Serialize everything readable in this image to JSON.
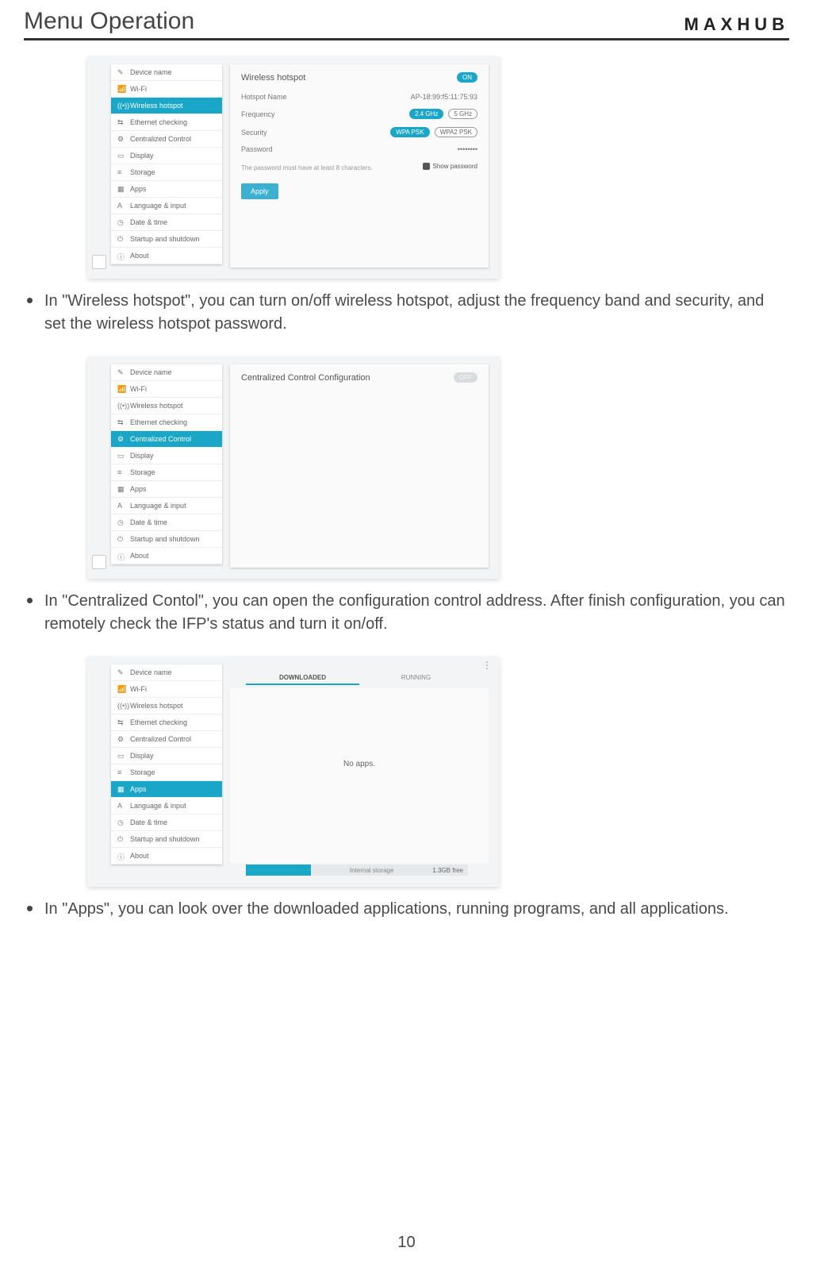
{
  "header": {
    "title": "Menu Operation",
    "brand": "MAXHUB"
  },
  "sidebar": {
    "items": [
      {
        "label": "Device name"
      },
      {
        "label": "Wi-Fi"
      },
      {
        "label": "Wireless hotspot"
      },
      {
        "label": "Ethernet checking"
      },
      {
        "label": "Centralized Control"
      },
      {
        "label": "Display"
      },
      {
        "label": "Storage"
      },
      {
        "label": "Apps"
      },
      {
        "label": "Language & input"
      },
      {
        "label": "Date & time"
      },
      {
        "label": "Startup and shutdown"
      },
      {
        "label": "About"
      }
    ]
  },
  "shot1": {
    "title": "Wireless hotspot",
    "toggle": "ON",
    "rows": {
      "name_label": "Hotspot Name",
      "name_value": "AP-18:99:f5:11:75:93",
      "freq_label": "Frequency",
      "freq_a": "2.4 GHz",
      "freq_b": "5 GHz",
      "sec_label": "Security",
      "sec_a": "WPA PSK",
      "sec_b": "WPA2 PSK",
      "pwd_label": "Password",
      "pwd_value": "••••••••",
      "hint": "The password must have at least 8 characters.",
      "show_pwd": "Show password"
    },
    "apply": "Apply"
  },
  "shot2": {
    "title": "Centralized Control Configuration",
    "toggle": "OFF"
  },
  "shot3": {
    "tabs": {
      "a": "DOWNLOADED",
      "b": "RUNNING"
    },
    "empty": "No apps.",
    "storage": {
      "used_label": "",
      "mid": "Internal storage",
      "free": "1.3GB free"
    }
  },
  "bullets": {
    "b1": "In \"Wireless hotspot\", you can turn on/off wireless hotspot, adjust the frequency band and security, and set the wireless hotspot password.",
    "b2": "In \"Centralized Contol\", you can open the configuration control address. After finish configuration, you can remotely check the IFP's status and turn it on/off.",
    "b3": "In \"Apps\", you can look over the downloaded applications, running programs, and all applications."
  },
  "page_number": "10"
}
